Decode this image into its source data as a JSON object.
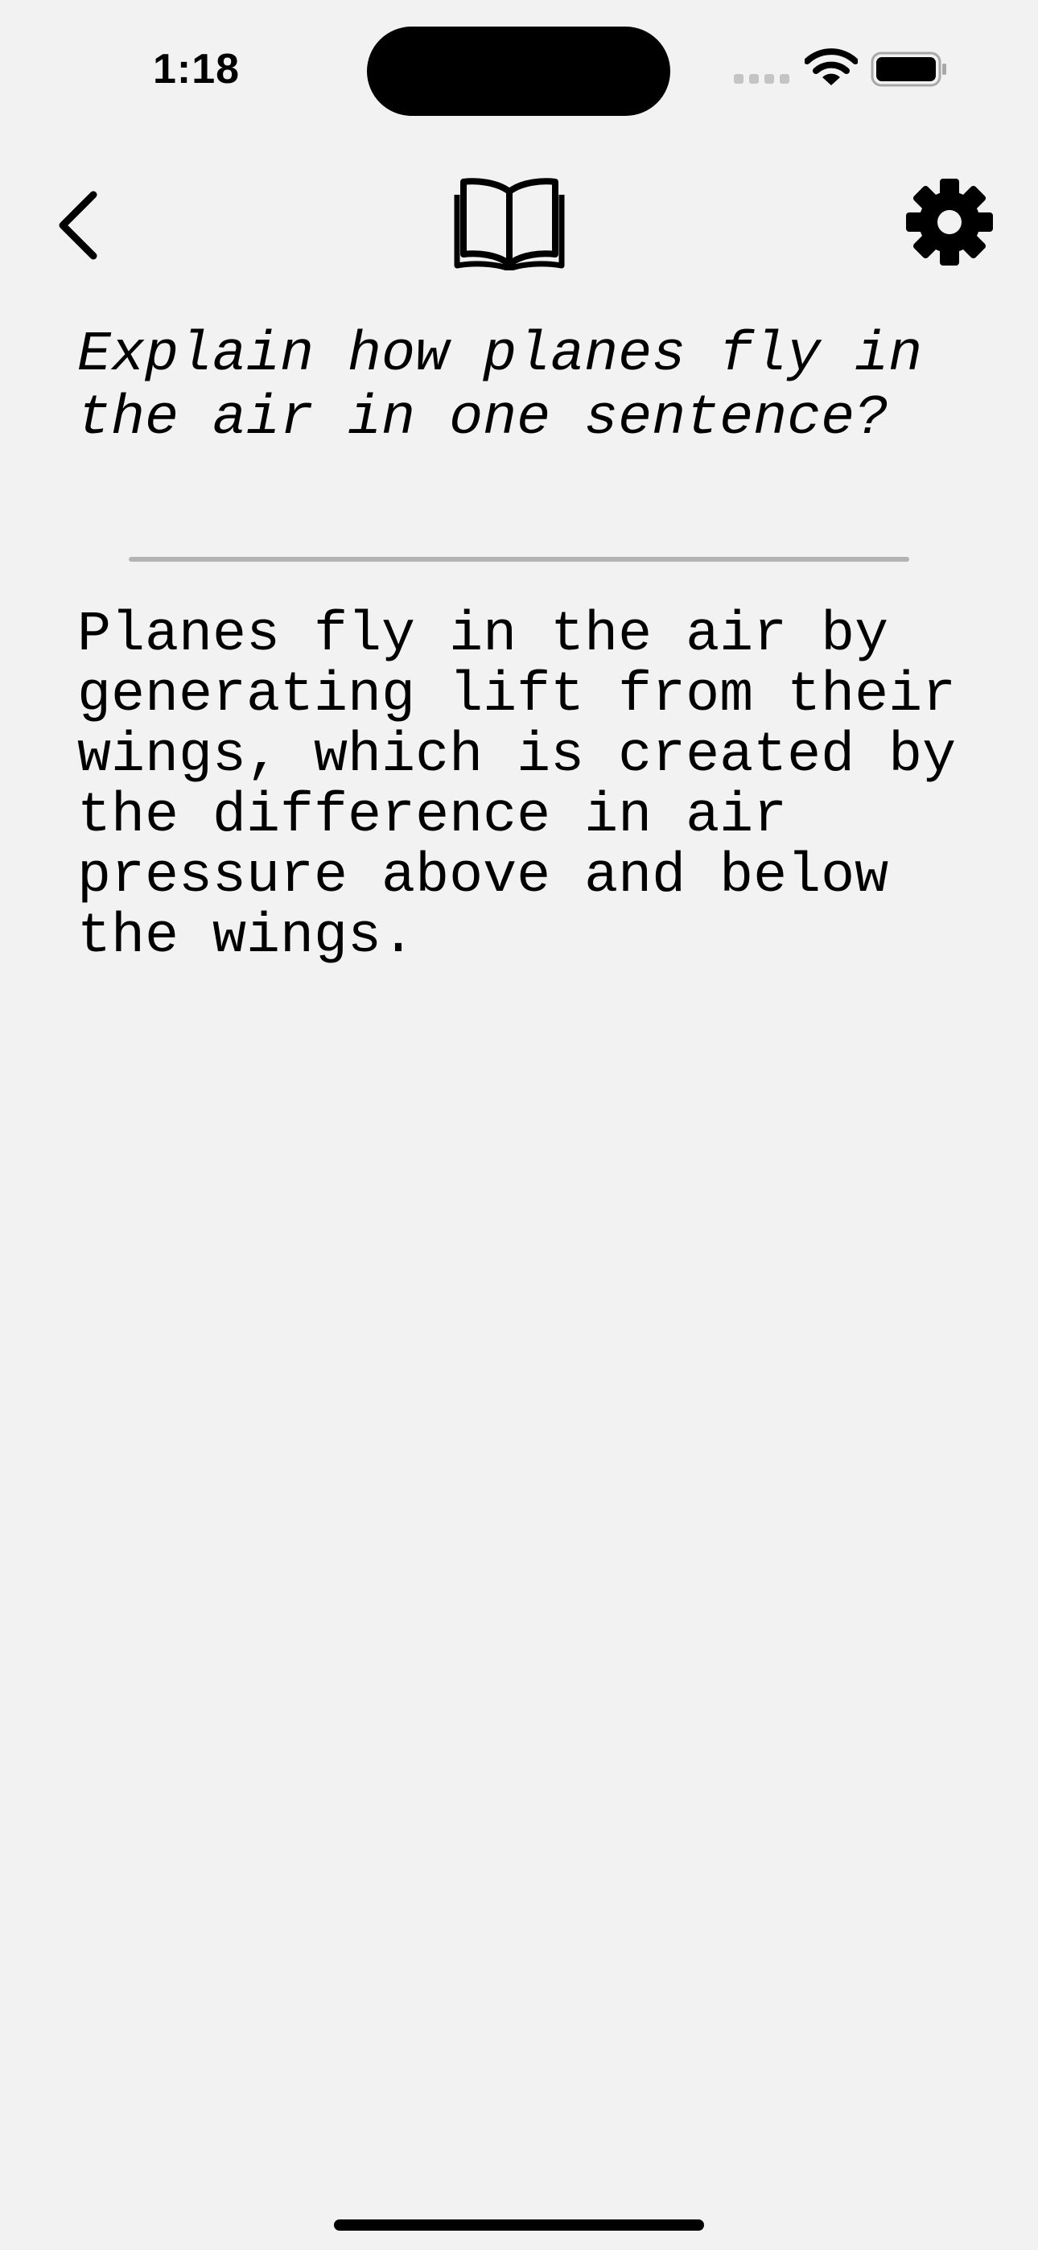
{
  "status_bar": {
    "time": "1:18",
    "icons": {
      "signal": "cellular-signal-icon",
      "wifi": "wifi-icon",
      "battery": "battery-icon"
    }
  },
  "nav": {
    "back_icon": "chevron-left-icon",
    "book_icon": "book-open-icon",
    "settings_icon": "gear-icon"
  },
  "conversation": {
    "question": "Explain how planes fly in\nthe air in one sentence?",
    "answer": "Planes fly in the air by\ngenerating lift from their\nwings, which is created by\nthe difference in air\npressure above and below\nthe wings."
  },
  "colors": {
    "background": "#f2f2f2",
    "text": "#000000",
    "divider": "#b3b3b3",
    "signal_inactive": "#c4c4c4"
  }
}
